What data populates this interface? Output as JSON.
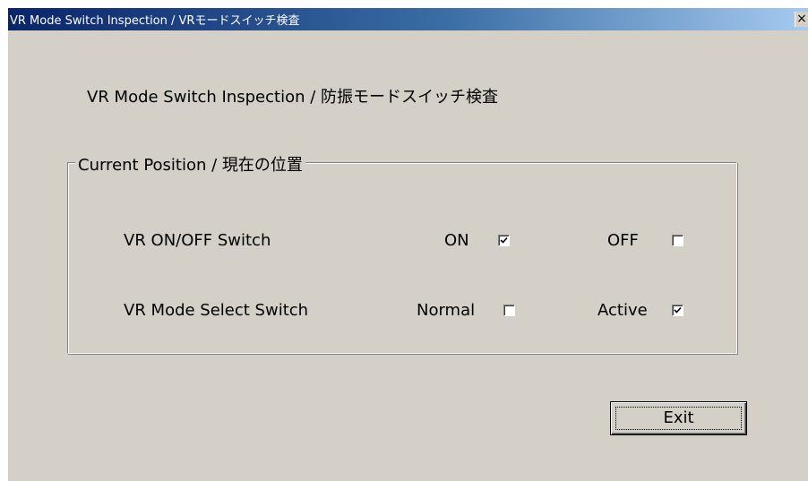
{
  "window": {
    "title": "VR Mode Switch Inspection / VRモードスイッチ検査",
    "close_symbol": "×"
  },
  "heading": "VR Mode Switch Inspection / 防振モードスイッチ検査",
  "group": {
    "legend": "Current Position / 現在の位置",
    "rows": [
      {
        "label": "VR ON/OFF Switch",
        "option_a": {
          "label": "ON",
          "checked": true
        },
        "option_b": {
          "label": "OFF",
          "checked": false
        }
      },
      {
        "label": "VR Mode Select Switch",
        "option_a": {
          "label": "Normal",
          "checked": false
        },
        "option_b": {
          "label": "Active",
          "checked": true
        }
      }
    ]
  },
  "buttons": {
    "exit_label": "Exit"
  },
  "colors": {
    "face": "#d4d0c8",
    "title_active_start": "#0a246a",
    "title_active_end": "#a6caf0"
  }
}
